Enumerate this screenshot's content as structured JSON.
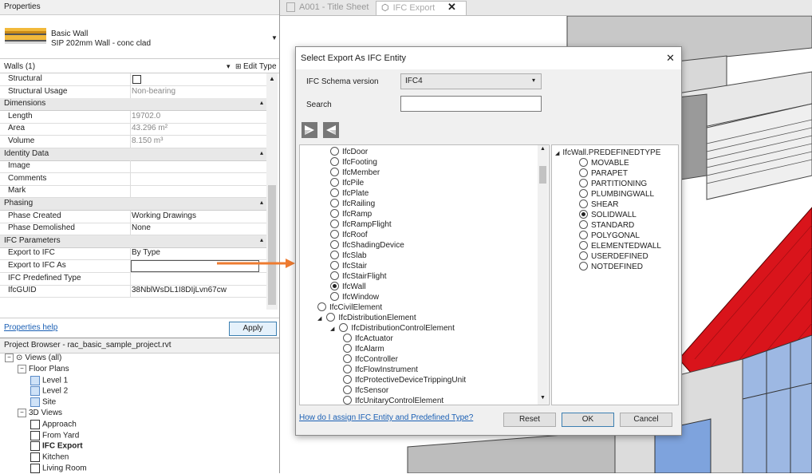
{
  "properties": {
    "title": "Properties",
    "type_family": "Basic Wall",
    "type_name": "SIP 202mm Wall - conc clad",
    "filter_label": "Walls (1)",
    "edit_type_label": "Edit Type",
    "rows": [
      {
        "kind": "row",
        "key": "Structural",
        "value": "",
        "checkbox": true
      },
      {
        "kind": "row",
        "key": "Structural Usage",
        "value": "Non-bearing",
        "gray": true
      },
      {
        "kind": "section",
        "key": "Dimensions"
      },
      {
        "kind": "row",
        "key": "Length",
        "value": "19702.0",
        "gray": true
      },
      {
        "kind": "row",
        "key": "Area",
        "value": "43.296 m²",
        "gray": true
      },
      {
        "kind": "row",
        "key": "Volume",
        "value": "8.150 m³",
        "gray": true
      },
      {
        "kind": "section",
        "key": "Identity Data"
      },
      {
        "kind": "row",
        "key": "Image",
        "value": ""
      },
      {
        "kind": "row",
        "key": "Comments",
        "value": ""
      },
      {
        "kind": "row",
        "key": "Mark",
        "value": ""
      },
      {
        "kind": "section",
        "key": "Phasing"
      },
      {
        "kind": "row",
        "key": "Phase Created",
        "value": "Working Drawings"
      },
      {
        "kind": "row",
        "key": "Phase Demolished",
        "value": "None"
      },
      {
        "kind": "section",
        "key": "IFC Parameters"
      },
      {
        "kind": "row",
        "key": "Export to IFC",
        "value": "By Type"
      },
      {
        "kind": "row",
        "key": "Export to IFC As",
        "value": "",
        "input": true
      },
      {
        "kind": "row",
        "key": "IFC Predefined Type",
        "value": ""
      },
      {
        "kind": "row",
        "key": "IfcGUID",
        "value": "38NblWsDL1I8DIjLvn67cw"
      }
    ],
    "help_link": "Properties help",
    "apply_label": "Apply"
  },
  "browser": {
    "title": "Project Browser - rac_basic_sample_project.rvt",
    "items": [
      {
        "label": "Views (all)",
        "level": 0,
        "toggle": "−",
        "icon": "views"
      },
      {
        "label": "Floor Plans",
        "level": 1,
        "toggle": "−"
      },
      {
        "label": "Level 1",
        "level": 2,
        "icon": "plan"
      },
      {
        "label": "Level 2",
        "level": 2,
        "icon": "plan"
      },
      {
        "label": "Site",
        "level": 2,
        "icon": "plan"
      },
      {
        "label": "3D Views",
        "level": 1,
        "toggle": "−"
      },
      {
        "label": "Approach",
        "level": 2,
        "icon": "3d"
      },
      {
        "label": "From Yard",
        "level": 2,
        "icon": "3d"
      },
      {
        "label": "IFC Export",
        "level": 2,
        "icon": "3d",
        "bold": true
      },
      {
        "label": "Kitchen",
        "level": 2,
        "icon": "3d"
      },
      {
        "label": "Living Room",
        "level": 2,
        "icon": "3d"
      }
    ]
  },
  "tabs": [
    {
      "label": "A001 - Title Sheet",
      "active": false
    },
    {
      "label": "IFC Export",
      "active": true
    }
  ],
  "dialog": {
    "title": "Select Export As IFC Entity",
    "schema_label": "IFC Schema version",
    "schema_value": "IFC4",
    "search_label": "Search",
    "search_value": "",
    "entities": [
      {
        "label": "IfcDoor",
        "indent": 3
      },
      {
        "label": "IfcFooting",
        "indent": 3
      },
      {
        "label": "IfcMember",
        "indent": 3
      },
      {
        "label": "IfcPile",
        "indent": 3
      },
      {
        "label": "IfcPlate",
        "indent": 3
      },
      {
        "label": "IfcRailing",
        "indent": 3
      },
      {
        "label": "IfcRamp",
        "indent": 3
      },
      {
        "label": "IfcRampFlight",
        "indent": 3
      },
      {
        "label": "IfcRoof",
        "indent": 3
      },
      {
        "label": "IfcShadingDevice",
        "indent": 3
      },
      {
        "label": "IfcSlab",
        "indent": 3
      },
      {
        "label": "IfcStair",
        "indent": 3
      },
      {
        "label": "IfcStairFlight",
        "indent": 3
      },
      {
        "label": "IfcWall",
        "indent": 3,
        "selected": true
      },
      {
        "label": "IfcWindow",
        "indent": 3
      },
      {
        "label": "IfcCivilElement",
        "indent": 2
      },
      {
        "label": "IfcDistributionElement",
        "indent": 2,
        "expander": true
      },
      {
        "label": "IfcDistributionControlElement",
        "indent": 3,
        "expander": true
      },
      {
        "label": "IfcActuator",
        "indent": 4
      },
      {
        "label": "IfcAlarm",
        "indent": 4
      },
      {
        "label": "IfcController",
        "indent": 4
      },
      {
        "label": "IfcFlowInstrument",
        "indent": 4
      },
      {
        "label": "IfcProtectiveDeviceTrippingUnit",
        "indent": 4
      },
      {
        "label": "IfcSensor",
        "indent": 4
      },
      {
        "label": "IfcUnitaryControlElement",
        "indent": 4
      }
    ],
    "predefined_header": "IfcWall.PREDEFINEDTYPE",
    "predefined": [
      {
        "label": "MOVABLE"
      },
      {
        "label": "PARAPET"
      },
      {
        "label": "PARTITIONING"
      },
      {
        "label": "PLUMBINGWALL"
      },
      {
        "label": "SHEAR"
      },
      {
        "label": "SOLIDWALL",
        "selected": true
      },
      {
        "label": "STANDARD"
      },
      {
        "label": "POLYGONAL"
      },
      {
        "label": "ELEMENTEDWALL"
      },
      {
        "label": "USERDEFINED"
      },
      {
        "label": "NOTDEFINED"
      }
    ],
    "help_link": "How do I assign IFC Entity and Predefined Type?",
    "reset_label": "Reset",
    "ok_label": "OK",
    "cancel_label": "Cancel"
  },
  "colors": {
    "roof": "#d9141b",
    "arrow": "#ee7b30",
    "link": "#1a5fb4",
    "accent": "#cfe2f7"
  }
}
